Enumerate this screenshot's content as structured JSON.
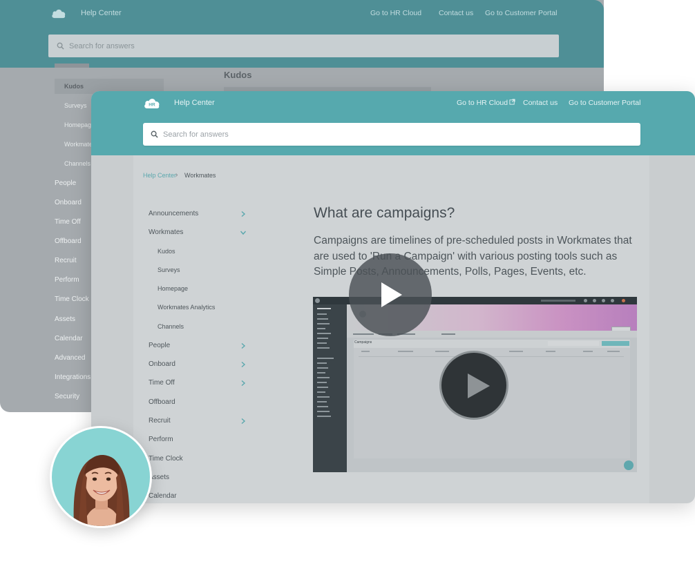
{
  "back_window": {
    "header": {
      "brand": "Help Center",
      "nav": [
        "Go to HR Cloud",
        "Contact us",
        "Go to Customer Portal"
      ]
    },
    "search": {
      "placeholder": "Search for answers"
    },
    "article_title": "Kudos",
    "sidebar": {
      "subitems": [
        "Kudos",
        "Surveys",
        "Homepage",
        "Workmates",
        "Channels"
      ],
      "items": [
        "People",
        "Onboard",
        "Time Off",
        "Offboard",
        "Recruit",
        "Perform",
        "Time Clock",
        "Assets",
        "Calendar",
        "Advanced",
        "Integrations",
        "Security"
      ]
    }
  },
  "front_window": {
    "header": {
      "logo_text": "HR",
      "brand": "Help Center",
      "nav": [
        "Go to HR Cloud",
        "Contact us",
        "Go to Customer Portal"
      ]
    },
    "search": {
      "placeholder": "Search for answers"
    },
    "breadcrumb": {
      "root": "Help Center",
      "current": "Workmates"
    },
    "sidebar": {
      "announcements": "Announcements",
      "workmates": "Workmates",
      "workmates_sub": [
        "Kudos",
        "Surveys",
        "Homepage",
        "Workmates Analytics",
        "Channels"
      ],
      "items": [
        "People",
        "Onboard",
        "Time Off",
        "Offboard",
        "Recruit",
        "Perform",
        "Time Clock",
        "Assets",
        "Calendar"
      ]
    },
    "article": {
      "title": "What are campaigns?",
      "body": "Campaigns are timelines of pre-scheduled posts in Workmates that are used to 'Run a Campaign' with various posting tools such as Simple Posts, Announcements, Polls, Pages, Events, etc."
    },
    "video": {
      "panel_title": "Campaigns"
    }
  },
  "colors": {
    "front_header": "#56a9ae",
    "back_header": "#4f8f96",
    "avatar_bg": "#88d4d3"
  }
}
